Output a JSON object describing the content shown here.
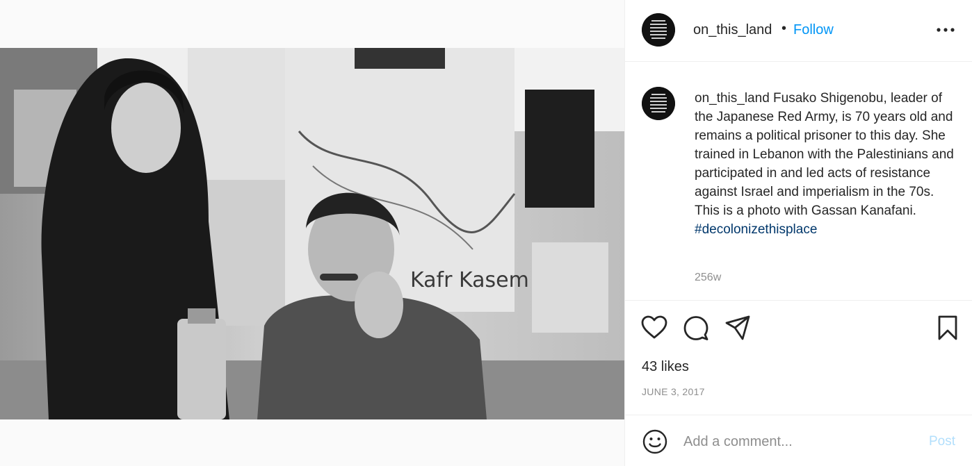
{
  "post": {
    "username": "on_this_land",
    "separator": "•",
    "follow_label": "Follow",
    "caption": "Fusako Shigenobu, leader of the Japanese Red Army, is 70 years old and remains a political prisoner to this day. She trained in Lebanon with the Palestinians and participated in and led acts of resistance against Israel and imperialism in the 70s. This is a photo with Gassan Kanafani.",
    "hashtag": "#decolonizethisplace",
    "time_ago": "256w",
    "likes": "43 likes",
    "date": "JUNE 3, 2017"
  },
  "photo": {
    "poster_text": "Kafr Kasem"
  },
  "comment": {
    "placeholder": "Add a comment...",
    "post_label": "Post"
  },
  "icons": {
    "more": "more-options-icon",
    "like": "heart-icon",
    "comment": "comment-bubble-icon",
    "share": "paper-plane-icon",
    "save": "bookmark-icon",
    "emoji": "emoji-smile-icon"
  },
  "colors": {
    "accent": "#0095f6",
    "hashtag": "#00376b",
    "post_disabled": "#b2dffc",
    "muted": "#8e8e8e"
  }
}
